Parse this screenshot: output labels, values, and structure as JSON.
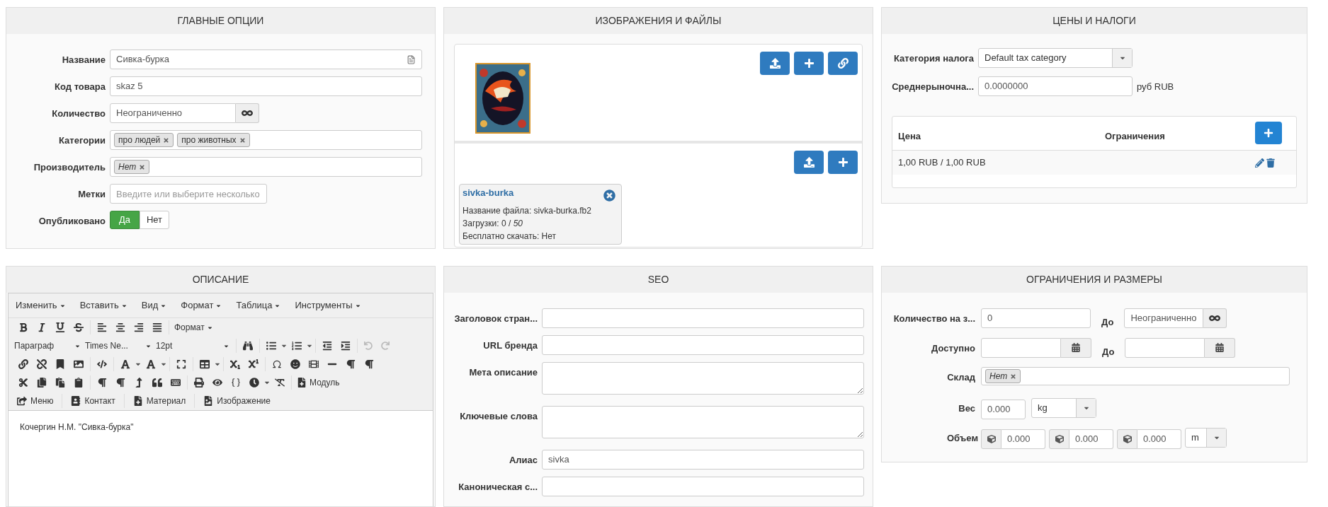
{
  "main_options": {
    "title": "ГЛАВНЫЕ ОПЦИИ",
    "fields": [
      {
        "kind": "text",
        "label": "Название",
        "value": "Сивка-бурка",
        "icon": true
      },
      {
        "kind": "text",
        "label": "Код товара",
        "value": "skaz 5"
      },
      {
        "kind": "infinite",
        "label": "Количество",
        "value": "Неограниченно"
      },
      {
        "kind": "tags",
        "label": "Категории",
        "tags": [
          {
            "text": "про людей",
            "italic": false
          },
          {
            "text": "про животных",
            "italic": false
          }
        ]
      },
      {
        "kind": "tags",
        "label": "Производитель",
        "tags": [
          {
            "text": "Нет",
            "italic": true
          }
        ]
      },
      {
        "kind": "tagsearch",
        "label": "Метки",
        "placeholder": "Введите или выберите несколько"
      },
      {
        "kind": "toggle",
        "label": "Опубликовано",
        "options": [
          {
            "label": "Да",
            "selected": true
          },
          {
            "label": "Нет",
            "selected": false
          }
        ]
      }
    ]
  },
  "images_files": {
    "title": "ИЗОБРАЖЕНИЯ И ФАЙЛЫ",
    "file": {
      "name": "sivka-burka",
      "lines": [
        "Название файла: sivka-burka.fb2",
        "Загрузки: 0 / *50*",
        "Бесплатно скачать: Нет"
      ]
    }
  },
  "prices_taxes": {
    "title": "ЦЕНЫ И НАЛОГИ",
    "tax_label": "Категория налога",
    "tax_value": "Default tax category",
    "market_label": "Среднерыночна...",
    "market_value": "0.0000000",
    "market_unit": "руб RUB",
    "columns": [
      "Цена",
      "Ограничения"
    ],
    "rows": [
      {
        "price": "1,00 RUB / 1,00 RUB"
      }
    ]
  },
  "description": {
    "title": "ОПИСАНИЕ",
    "menus": [
      "Изменить",
      "Вставить",
      "Вид",
      "Формат",
      "Таблица",
      "Инструменты"
    ],
    "format_button": "Формат",
    "selects": [
      "Параграф",
      "Times Ne...",
      "12pt"
    ],
    "module_button": "Модуль",
    "insert_buttons": [
      "Меню",
      "Контакт",
      "Материал",
      "Изображение"
    ],
    "content": "Кочергин Н.М. \"Сивка-бурка\""
  },
  "seo": {
    "title": "SEO",
    "fields": [
      {
        "kind": "text",
        "label": "Заголовок стран..."
      },
      {
        "kind": "text",
        "label": "URL бренда"
      },
      {
        "kind": "textarea",
        "label": "Мета описание"
      },
      {
        "kind": "textarea",
        "label": "Ключевые слова"
      },
      {
        "kind": "text",
        "label": "Алиас",
        "value": "sivka"
      },
      {
        "kind": "text",
        "label": "Каноническая с..."
      }
    ]
  },
  "limits": {
    "title": "ОГРАНИЧЕНИЯ И РАЗМЕРЫ",
    "order_label": "Количество на з...",
    "order_min": "0",
    "to_label": "До",
    "order_max": "Неограниченно",
    "available_label": "Доступно",
    "available_to_label": "До",
    "stock_label": "Склад",
    "stock_tag": {
      "text": "Нет",
      "italic": true
    },
    "weight_label": "Вес",
    "weight_value": "0.000",
    "weight_unit": "kg",
    "volume_label": "Объем",
    "volume_values": [
      "0.000",
      "0.000",
      "0.000"
    ],
    "volume_unit": "m"
  }
}
